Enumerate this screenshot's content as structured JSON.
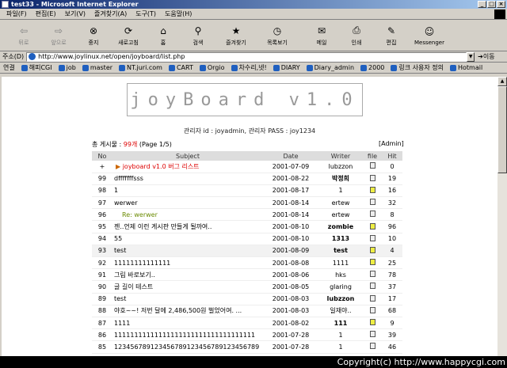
{
  "window": {
    "title": "test33 - Microsoft Internet Explorer"
  },
  "menu": [
    "파일(F)",
    "편집(E)",
    "보기(V)",
    "즐겨찾기(A)",
    "도구(T)",
    "도움말(H)"
  ],
  "toolbar": [
    "뒤로",
    "앞으로",
    "중지",
    "새로고침",
    "홈",
    "검색",
    "즐겨찾기",
    "목록보기",
    "메일",
    "인쇄",
    "편집",
    "Messenger"
  ],
  "address": {
    "label": "주소(D)",
    "url": "http://www.joylinux.net/open/joyboard/list.php",
    "go": "이동"
  },
  "links": {
    "label": "연결",
    "items": [
      "해피CGI",
      "job",
      "master",
      "NT.juri.com",
      "CART",
      "Orgio",
      "차수리,넷!",
      "DIARY",
      "Diary_admin",
      "2000",
      "링크 사용자 정의",
      "Hotmail"
    ]
  },
  "board": {
    "logo": "joyBoard v1.0",
    "admin_line": "관리자 id : joyadmin, 관리자 PASS : joy1234",
    "count_prefix": "총 게시물 : ",
    "count_num": "99개",
    "count_page": " (Page 1/5)",
    "admin_link": "[Admin]",
    "headers": [
      "No",
      "Subject",
      "Date",
      "Writer",
      "file",
      "Hit"
    ],
    "rows": [
      {
        "no": "+",
        "subject": "joyboard v1.0 버그 리스트",
        "date": "2001-07-09",
        "writer": "lubzzon",
        "file": "doc",
        "hit": "0"
      },
      {
        "no": "99",
        "subject": "dfffffffsss",
        "date": "2001-08-22",
        "writer": "박정희",
        "file": "doc",
        "hit": "19"
      },
      {
        "no": "98",
        "subject": "1",
        "date": "2001-08-17",
        "writer": "1",
        "file": "snd",
        "hit": "16"
      },
      {
        "no": "97",
        "subject": "werwer",
        "date": "2001-08-14",
        "writer": "ertew",
        "file": "doc",
        "hit": "32"
      },
      {
        "no": "96",
        "subject": "Re: werwer",
        "date": "2001-08-14",
        "writer": "ertew",
        "file": "doc",
        "hit": "8"
      },
      {
        "no": "95",
        "subject": "젠..언제 이런 게시판 만들게 될까여..",
        "date": "2001-08-10",
        "writer": "zombie",
        "file": "snd",
        "hit": "96"
      },
      {
        "no": "94",
        "subject": "55",
        "date": "2001-08-10",
        "writer": "1313",
        "file": "doc",
        "hit": "10"
      },
      {
        "no": "93",
        "subject": "test",
        "date": "2001-08-09",
        "writer": "test",
        "file": "snd",
        "hit": "4"
      },
      {
        "no": "92",
        "subject": "11111111111111",
        "date": "2001-08-08",
        "writer": "1111",
        "file": "snd",
        "hit": "25"
      },
      {
        "no": "91",
        "subject": "그림 바로보기..",
        "date": "2001-08-06",
        "writer": "hks",
        "file": "doc",
        "hit": "78"
      },
      {
        "no": "90",
        "subject": "글 길이 테스트",
        "date": "2001-08-05",
        "writer": "glaring",
        "file": "doc",
        "hit": "37"
      },
      {
        "no": "89",
        "subject": "test",
        "date": "2001-08-03",
        "writer": "lubzzon",
        "file": "doc",
        "hit": "17"
      },
      {
        "no": "88",
        "subject": "야호~~! 저번 달에 2,486,500원 벌었어여. ...",
        "date": "2001-08-03",
        "writer": "일재야..",
        "file": "doc",
        "hit": "68"
      },
      {
        "no": "87",
        "subject": "1111",
        "date": "2001-08-02",
        "writer": "111",
        "file": "snd",
        "hit": "9"
      },
      {
        "no": "86",
        "subject": "11111111111111111111111111111111111",
        "date": "2001-07-28",
        "writer": "1",
        "file": "doc",
        "hit": "39"
      },
      {
        "no": "85",
        "subject": "12345678912345678912345678912345678​9",
        "date": "2001-07-28",
        "writer": "1",
        "file": "doc",
        "hit": "46"
      }
    ]
  },
  "copyright": "Copyright(c) http://www.happycgi.com"
}
